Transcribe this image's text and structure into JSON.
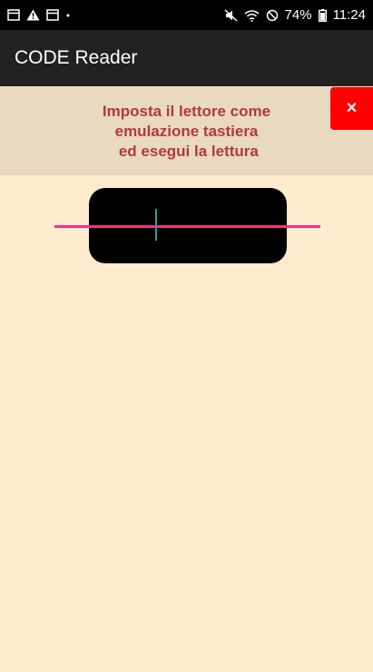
{
  "status_bar": {
    "left_icons": [
      "calendar-icon",
      "warning-icon",
      "calendar-icon",
      "dot-icon"
    ],
    "right_icons": [
      "mute-icon",
      "wifi-icon",
      "blocked-icon"
    ],
    "battery_percent": "74%",
    "time": "11:24"
  },
  "app_bar": {
    "title": "CODE Reader"
  },
  "banner": {
    "lines": [
      "Imposta il lettore come",
      "emulazione tastiera",
      " ed esegui la lettura"
    ],
    "close_label": "×"
  },
  "colors": {
    "background": "#ffebcd",
    "banner": "#e8d9c0",
    "banner_text": "#b23a3a",
    "close": "#ff0000",
    "scan_line": "#ff2a8a",
    "cursor": "#1aa69b"
  }
}
